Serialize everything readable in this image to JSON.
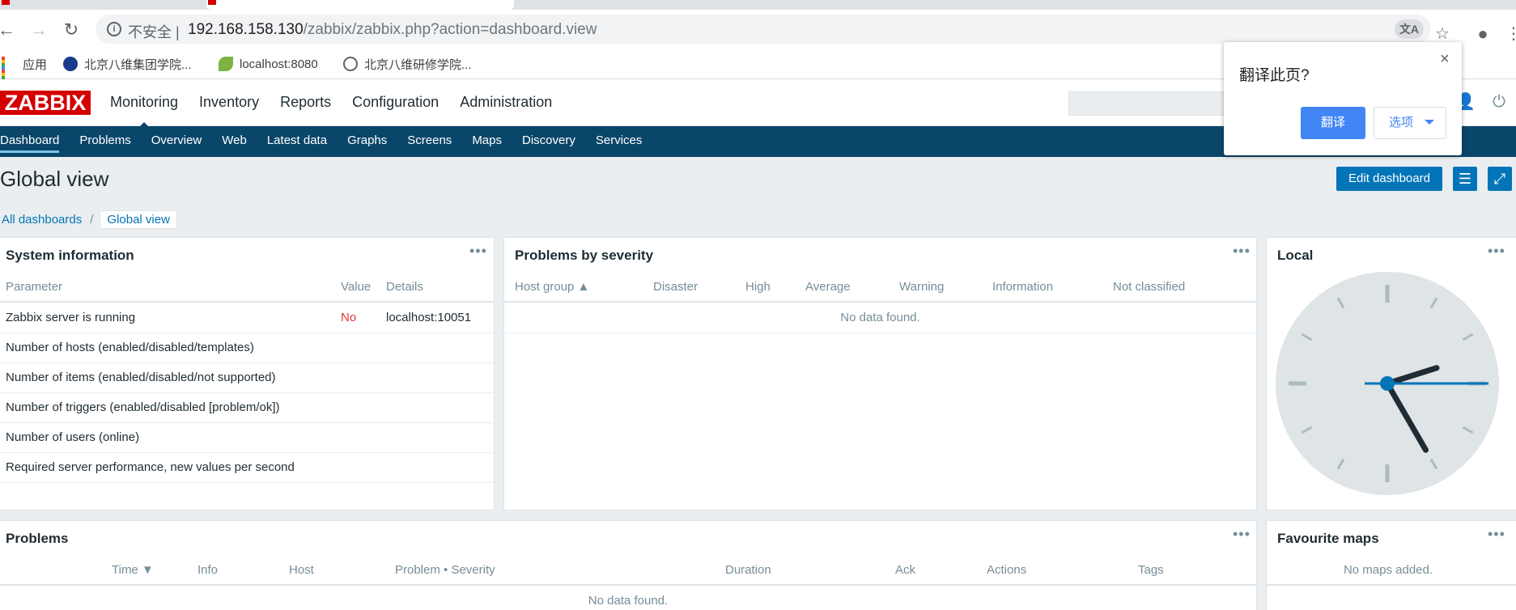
{
  "browser": {
    "insecure_label": "不安全 |",
    "url_host": "192.168.158.130",
    "url_path": "/zabbix/zabbix.php?action=dashboard.view",
    "icons": [
      "back-icon",
      "forward-icon",
      "reload-icon",
      "translate-icon",
      "star-icon",
      "account-icon",
      "menu-icon"
    ],
    "bookmarks": [
      {
        "label": "应用",
        "icon": "apps-icon"
      },
      {
        "label": "北京八维集团学院...",
        "icon": "site-icon"
      },
      {
        "label": "localhost:8080",
        "icon": "leaf-icon"
      },
      {
        "label": "北京八维研修学院...",
        "icon": "globe-icon"
      }
    ]
  },
  "translate_popup": {
    "question": "翻译此页?",
    "translate_button": "翻译",
    "options_button": "选项",
    "close": "×"
  },
  "zabbix": {
    "logo": "ZABBIX",
    "brand_color": "#d40000",
    "nav_color": "#0a466a",
    "accent_color": "#0275b8",
    "top_menu": [
      "Monitoring",
      "Inventory",
      "Reports",
      "Configuration",
      "Administration"
    ],
    "sub_menu": [
      "Dashboard",
      "Problems",
      "Overview",
      "Web",
      "Latest data",
      "Graphs",
      "Screens",
      "Maps",
      "Discovery",
      "Services"
    ],
    "page_title": "Global view",
    "edit_button": "Edit dashboard",
    "breadcrumb": {
      "root": "All dashboards",
      "sep": "/",
      "current": "Global view"
    }
  },
  "system_info": {
    "title": "System information",
    "headers": [
      "Parameter",
      "Value",
      "Details"
    ],
    "rows": [
      {
        "parameter": "Zabbix server is running",
        "value": "No",
        "details": "localhost:10051"
      },
      {
        "parameter": "Number of hosts (enabled/disabled/templates)",
        "value": "",
        "details": ""
      },
      {
        "parameter": "Number of items (enabled/disabled/not supported)",
        "value": "",
        "details": ""
      },
      {
        "parameter": "Number of triggers (enabled/disabled [problem/ok])",
        "value": "",
        "details": ""
      },
      {
        "parameter": "Number of users (online)",
        "value": "",
        "details": ""
      },
      {
        "parameter": "Required server performance, new values per second",
        "value": "",
        "details": ""
      }
    ]
  },
  "problems_by_severity": {
    "title": "Problems by severity",
    "headers": [
      "Host group ▲",
      "Disaster",
      "High",
      "Average",
      "Warning",
      "Information",
      "Not classified"
    ],
    "empty": "No data found."
  },
  "clock": {
    "title": "Local",
    "hour": 2,
    "minute": 25,
    "second": 15
  },
  "problems": {
    "title": "Problems",
    "headers": [
      "Time ▼",
      "Info",
      "Host",
      "Problem • Severity",
      "Duration",
      "Ack",
      "Actions",
      "Tags"
    ],
    "empty": "No data found."
  },
  "favourite_maps": {
    "title": "Favourite maps",
    "empty": "No maps added."
  },
  "widget_menu": "•••"
}
